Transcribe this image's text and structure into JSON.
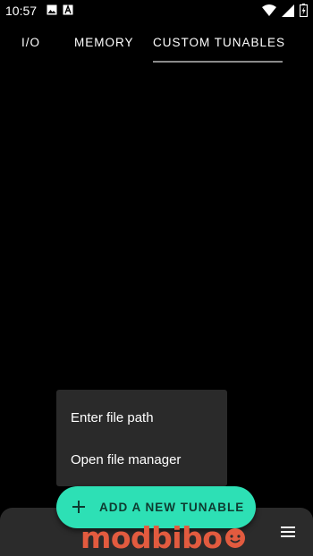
{
  "status_bar": {
    "time": "10:57",
    "left_icons": [
      "image-icon",
      "a-icon"
    ],
    "right_icons": [
      "wifi-icon",
      "signal-icon",
      "battery-icon"
    ]
  },
  "tabs": [
    {
      "label": "I/O",
      "selected": false
    },
    {
      "label": "MEMORY",
      "selected": false
    },
    {
      "label": "CUSTOM TUNABLES",
      "selected": true
    }
  ],
  "popup_menu": {
    "items": [
      {
        "label": "Enter file path"
      },
      {
        "label": "Open file manager"
      }
    ]
  },
  "fab": {
    "label": "ADD A NEW TUNABLE",
    "icon": "plus-icon"
  },
  "bottom_bar": {
    "menu_icon": "hamburger-menu-icon"
  },
  "watermark": {
    "text": "modbibo"
  },
  "colors": {
    "background": "#000000",
    "accent": "#2de0b5",
    "menu_background": "#2a2a2a",
    "bottom_bar": "#2b2b2b",
    "watermark": "#e25b3f"
  }
}
